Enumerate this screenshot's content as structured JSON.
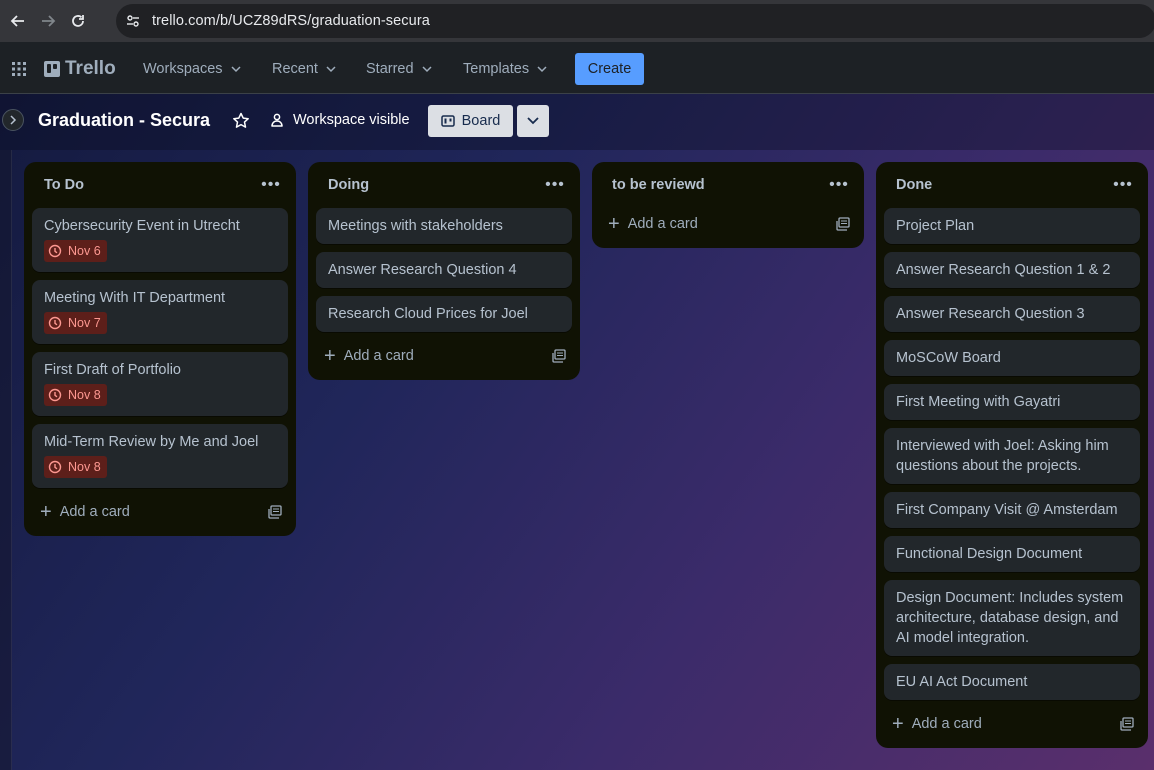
{
  "browser": {
    "url": "trello.com/b/UCZ89dRS/graduation-secura"
  },
  "header": {
    "logo_text": "Trello",
    "menu": [
      "Workspaces",
      "Recent",
      "Starred",
      "Templates"
    ],
    "create_label": "Create"
  },
  "board": {
    "title": "Graduation - Secura",
    "visibility_label": "Workspace visible",
    "view_label": "Board"
  },
  "lists": [
    {
      "title": "To Do",
      "cards": [
        {
          "title": "Cybersecurity Event in Utrecht",
          "due": "Nov 6"
        },
        {
          "title": "Meeting With IT Department",
          "due": "Nov 7"
        },
        {
          "title": "First Draft of Portfolio",
          "due": "Nov 8"
        },
        {
          "title": "Mid-Term Review by Me and Joel",
          "due": "Nov 8"
        }
      ],
      "add_label": "Add a card"
    },
    {
      "title": "Doing",
      "cards": [
        {
          "title": "Meetings with stakeholders"
        },
        {
          "title": "Answer Research Question 4"
        },
        {
          "title": "Research Cloud Prices for Joel"
        }
      ],
      "add_label": "Add a card"
    },
    {
      "title": "to be reviewd",
      "cards": [],
      "add_label": "Add a card"
    },
    {
      "title": "Done",
      "cards": [
        {
          "title": "Project Plan"
        },
        {
          "title": "Answer Research Question 1 & 2"
        },
        {
          "title": "Answer Research Question 3"
        },
        {
          "title": "MoSCoW Board"
        },
        {
          "title": "First Meeting with Gayatri"
        },
        {
          "title": "Interviewed with Joel: Asking him questions about the projects."
        },
        {
          "title": "First Company Visit @ Amsterdam"
        },
        {
          "title": "Functional Design Document"
        },
        {
          "title": "Design Document: Includes system architecture, database design, and AI model integration."
        },
        {
          "title": "EU AI Act Document"
        }
      ],
      "add_label": "Add a card"
    }
  ],
  "colors": {
    "create_button": "#579dff",
    "due_badge_bg": "#5d1f1a",
    "due_badge_text": "#fd9891",
    "list_bg": "#101204",
    "card_bg": "#22272b"
  }
}
